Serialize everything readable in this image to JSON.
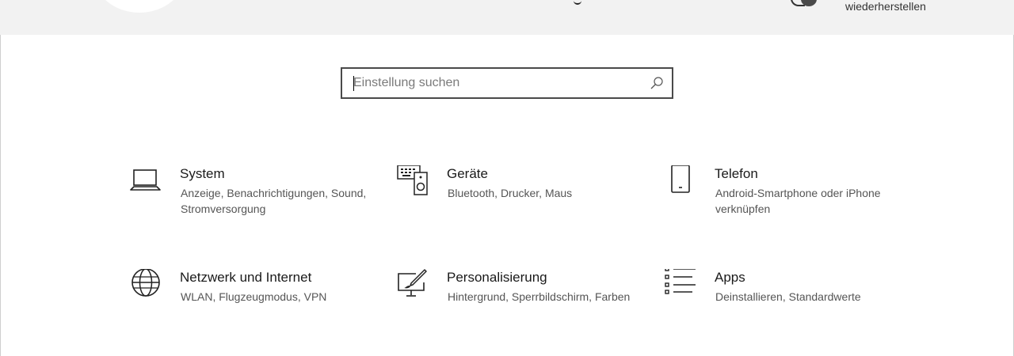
{
  "header": {
    "restore_label": "wiederherstellen"
  },
  "search": {
    "placeholder": "Einstellung suchen",
    "value": ""
  },
  "categories": [
    {
      "title": "System",
      "description": "Anzeige, Benachrichtigungen, Sound, Stromversorgung",
      "icon": "laptop-icon"
    },
    {
      "title": "Geräte",
      "description": "Bluetooth, Drucker, Maus",
      "icon": "devices-icon"
    },
    {
      "title": "Telefon",
      "description": "Android-Smartphone oder iPhone verknüpfen",
      "icon": "phone-icon"
    },
    {
      "title": "Netzwerk und Internet",
      "description": "WLAN, Flugzeugmodus, VPN",
      "icon": "globe-icon"
    },
    {
      "title": "Personalisierung",
      "description": "Hintergrund, Sperrbildschirm, Farben",
      "icon": "paint-monitor-icon"
    },
    {
      "title": "Apps",
      "description": "Deinstallieren, Standardwerte",
      "icon": "apps-list-icon"
    }
  ]
}
